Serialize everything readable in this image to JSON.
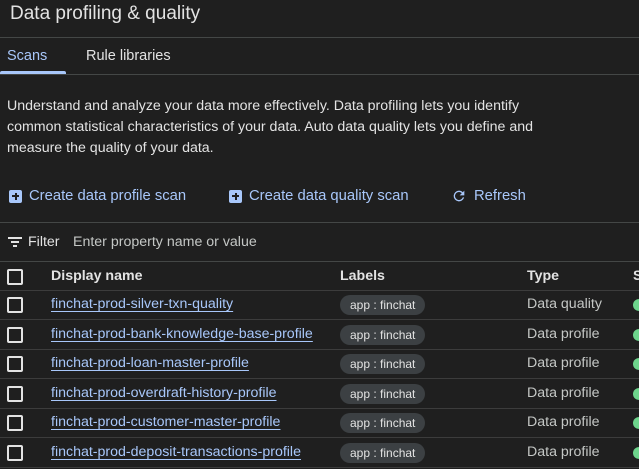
{
  "header": {
    "title": "Data profiling & quality"
  },
  "tabs": [
    {
      "label": "Scans",
      "active": true
    },
    {
      "label": "Rule libraries",
      "active": false
    }
  ],
  "description": "Understand and analyze your data more effectively. Data profiling lets you identify common statistical characteristics of your data. Auto data quality lets you define and measure the quality of your data.",
  "actions": {
    "create_profile": "Create data profile scan",
    "create_quality": "Create data quality scan",
    "refresh": "Refresh"
  },
  "filter": {
    "label": "Filter",
    "placeholder": "Enter property name or value"
  },
  "table": {
    "columns": {
      "display_name": "Display name",
      "labels": "Labels",
      "type": "Type",
      "status": "S"
    },
    "rows": [
      {
        "name": "finchat-prod-silver-txn-quality",
        "label": "app : finchat",
        "type": "Data quality"
      },
      {
        "name": "finchat-prod-bank-knowledge-base-profile",
        "label": "app : finchat",
        "type": "Data profile"
      },
      {
        "name": "finchat-prod-loan-master-profile",
        "label": "app : finchat",
        "type": "Data profile"
      },
      {
        "name": "finchat-prod-overdraft-history-profile",
        "label": "app : finchat",
        "type": "Data profile"
      },
      {
        "name": "finchat-prod-customer-master-profile",
        "label": "app : finchat",
        "type": "Data profile"
      },
      {
        "name": "finchat-prod-deposit-transactions-profile",
        "label": "app : finchat",
        "type": "Data profile"
      }
    ]
  },
  "colors": {
    "background": "#1f1f1f",
    "accent": "#a8c7fa",
    "status_success": "#6dd58c"
  }
}
